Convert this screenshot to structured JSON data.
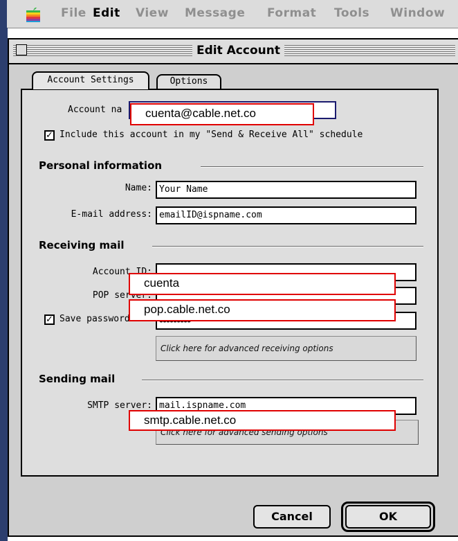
{
  "menubar": {
    "items": [
      "File",
      "Edit",
      "View",
      "Message",
      "Format",
      "Tools",
      "Window"
    ],
    "active": "Edit"
  },
  "window": {
    "title": "Edit Account"
  },
  "tabs": {
    "account_settings": "Account Settings",
    "options": "Options"
  },
  "account": {
    "name_label": "Account na",
    "include_label": "Include this account in my \"Send & Receive All\" schedule",
    "include_checked": true
  },
  "personal": {
    "heading": "Personal information",
    "name_label": "Name:",
    "name_value": "Your Name",
    "email_label": "E-mail address:",
    "email_value": "emailID@ispname.com"
  },
  "receiving": {
    "heading": "Receiving mail",
    "account_id_label": "Account ID:",
    "pop_label": "POP server:",
    "save_password_label": "Save password:",
    "save_password_checked": true,
    "password_mask": "●●●●●●●●●",
    "advanced_label": "Click here for advanced receiving options"
  },
  "sending": {
    "heading": "Sending mail",
    "smtp_label": "SMTP server:",
    "smtp_value": "mail.ispname.com",
    "advanced_label": "Click here for advanced sending options"
  },
  "overlays": {
    "account_name": "cuenta@cable.net.co",
    "account_id": "cuenta",
    "pop_server": "pop.cable.net.co",
    "smtp_server": "smtp.cable.net.co"
  },
  "buttons": {
    "cancel": "Cancel",
    "ok": "OK"
  },
  "colors": {
    "overlay_border": "#e00000",
    "desktop_edge": "#2c3e6e"
  }
}
